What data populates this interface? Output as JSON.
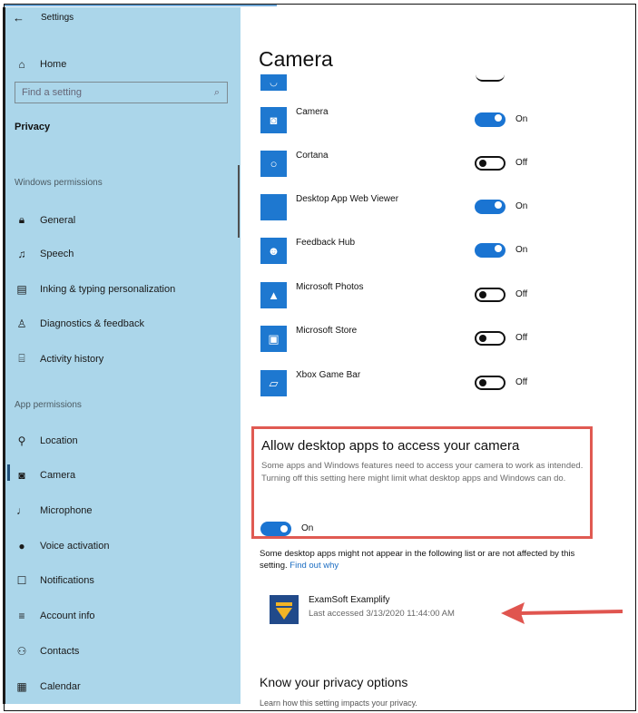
{
  "window": {
    "back_icon": "←",
    "title": "Settings"
  },
  "sidebar": {
    "home": "Home",
    "search_placeholder": "Find a setting",
    "search_icon": "⌕",
    "privacy": "Privacy",
    "section_windows": "Windows permissions",
    "windows_items": [
      {
        "label": "General",
        "icon": "lock-icon"
      },
      {
        "label": "Speech",
        "icon": "speech-icon"
      },
      {
        "label": "Inking & typing personalization",
        "icon": "clipboard-icon"
      },
      {
        "label": "Diagnostics & feedback",
        "icon": "feedback-icon"
      },
      {
        "label": "Activity history",
        "icon": "history-icon"
      }
    ],
    "section_app": "App permissions",
    "app_items": [
      {
        "label": "Location",
        "icon": "location-icon"
      },
      {
        "label": "Camera",
        "icon": "camera-icon",
        "selected": true
      },
      {
        "label": "Microphone",
        "icon": "microphone-icon"
      },
      {
        "label": "Voice activation",
        "icon": "voice-activation-icon"
      },
      {
        "label": "Notifications",
        "icon": "notifications-icon"
      },
      {
        "label": "Account info",
        "icon": "account-info-icon"
      },
      {
        "label": "Contacts",
        "icon": "contacts-icon"
      },
      {
        "label": "Calendar",
        "icon": "calendar-icon"
      }
    ]
  },
  "main": {
    "page_title": "Camera",
    "apps": [
      {
        "name": "Camera",
        "state": "On",
        "on": true
      },
      {
        "name": "Cortana",
        "state": "Off",
        "on": false
      },
      {
        "name": "Desktop App Web Viewer",
        "state": "On",
        "on": true
      },
      {
        "name": "Feedback Hub",
        "state": "On",
        "on": true
      },
      {
        "name": "Microsoft Photos",
        "state": "Off",
        "on": false
      },
      {
        "name": "Microsoft Store",
        "state": "Off",
        "on": false
      },
      {
        "name": "Xbox Game Bar",
        "state": "Off",
        "on": false
      }
    ],
    "desktop_section": {
      "title": "Allow desktop apps to access your camera",
      "description": "Some apps and Windows features need to access your camera to work as intended. Turning off this setting here might limit what desktop apps and Windows can do.",
      "toggle_state": "On"
    },
    "note": "Some desktop apps might not appear in the following list or are not affected by this setting.",
    "note_link": "Find out why",
    "desktop_app": {
      "name": "ExamSoft Examplify",
      "last_accessed": "Last accessed 3/13/2020 11:44:00 AM"
    },
    "privacy_title": "Know your privacy options",
    "privacy_sub": "Learn how this setting impacts your privacy."
  },
  "colors": {
    "sidebar_bg": "#abd6ea",
    "accent": "#1a74d2",
    "highlight_border": "#e05a52",
    "arrow": "#e0554f"
  }
}
